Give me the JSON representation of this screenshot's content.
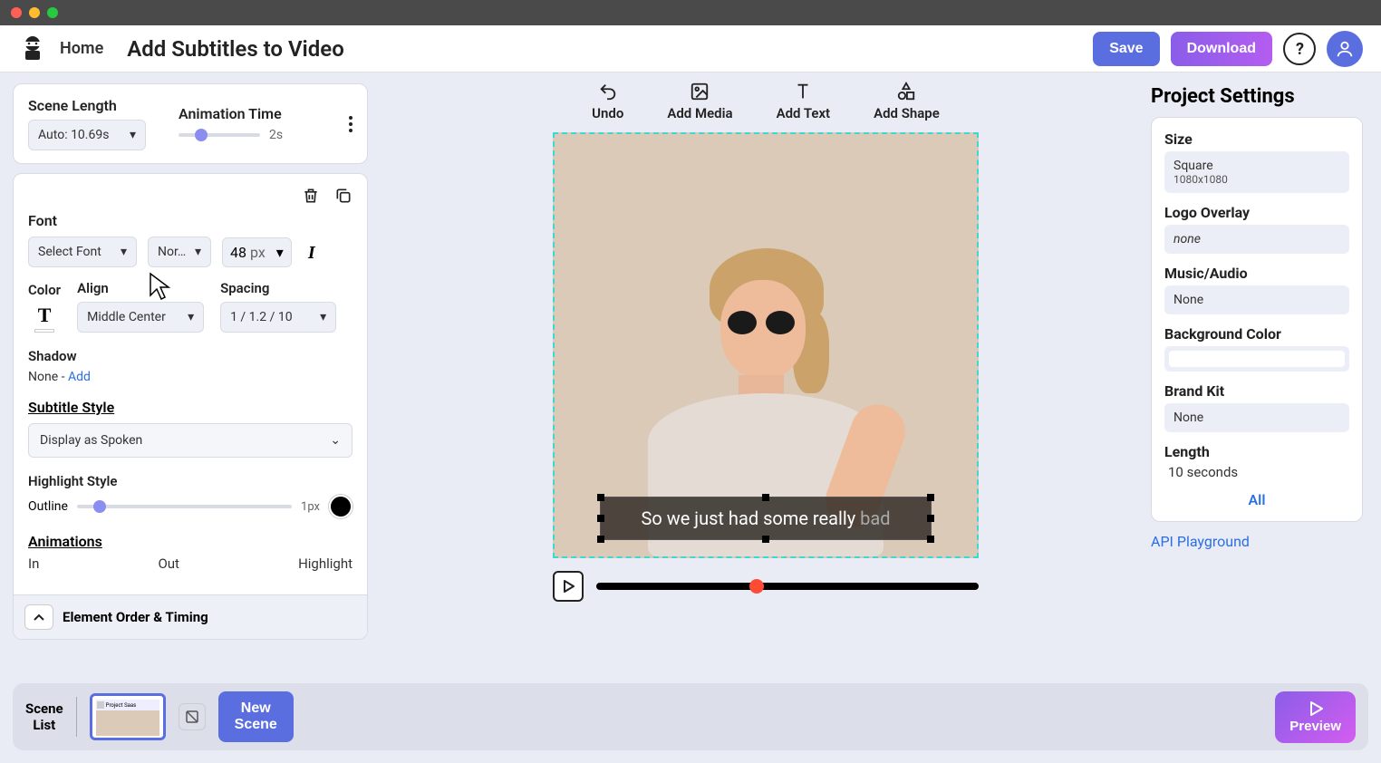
{
  "header": {
    "home": "Home",
    "title": "Add Subtitles to Video",
    "save": "Save",
    "download": "Download"
  },
  "scene_panel": {
    "length_label": "Scene Length",
    "length_value": "Auto: 10.69s",
    "anim_label": "Animation Time",
    "anim_value": "2s"
  },
  "font_panel": {
    "font_heading": "Font",
    "font_select": "Select Font",
    "weight": "Nor…",
    "size_num": "48",
    "size_unit": "px",
    "color_label": "Color",
    "align_label": "Align",
    "align_value": "Middle Center",
    "spacing_label": "Spacing",
    "spacing_value": "1 / 1.2 / 10",
    "shadow_label": "Shadow",
    "shadow_value": "None",
    "shadow_sep": " - ",
    "shadow_add": "Add",
    "subtitle_style_label": "Subtitle Style",
    "subtitle_style_value": "Display as Spoken",
    "highlight_label": "Highlight Style",
    "highlight_mode": "Outline",
    "highlight_px": "1px",
    "anim_heading": "Animations",
    "anim_in": "In",
    "anim_out": "Out",
    "anim_hl": "Highlight",
    "eot_label": "Element Order & Timing"
  },
  "toolbar": {
    "undo": "Undo",
    "add_media": "Add Media",
    "add_text": "Add Text",
    "add_shape": "Add Shape"
  },
  "subtitle": {
    "text_main": "So we just had some really ",
    "text_faded": "bad"
  },
  "project": {
    "title": "Project Settings",
    "size_label": "Size",
    "size_name": "Square",
    "size_dim": "1080x1080",
    "logo_label": "Logo Overlay",
    "logo_value": "none",
    "music_label": "Music/Audio",
    "music_value": "None",
    "bg_label": "Background Color",
    "brand_label": "Brand Kit",
    "brand_value": "None",
    "length_label": "Length",
    "length_value": "10 seconds",
    "all": "All",
    "api": "API Playground"
  },
  "bottom": {
    "scene_list": "Scene\nList",
    "new_scene": "New\nScene",
    "preview": "Preview"
  }
}
